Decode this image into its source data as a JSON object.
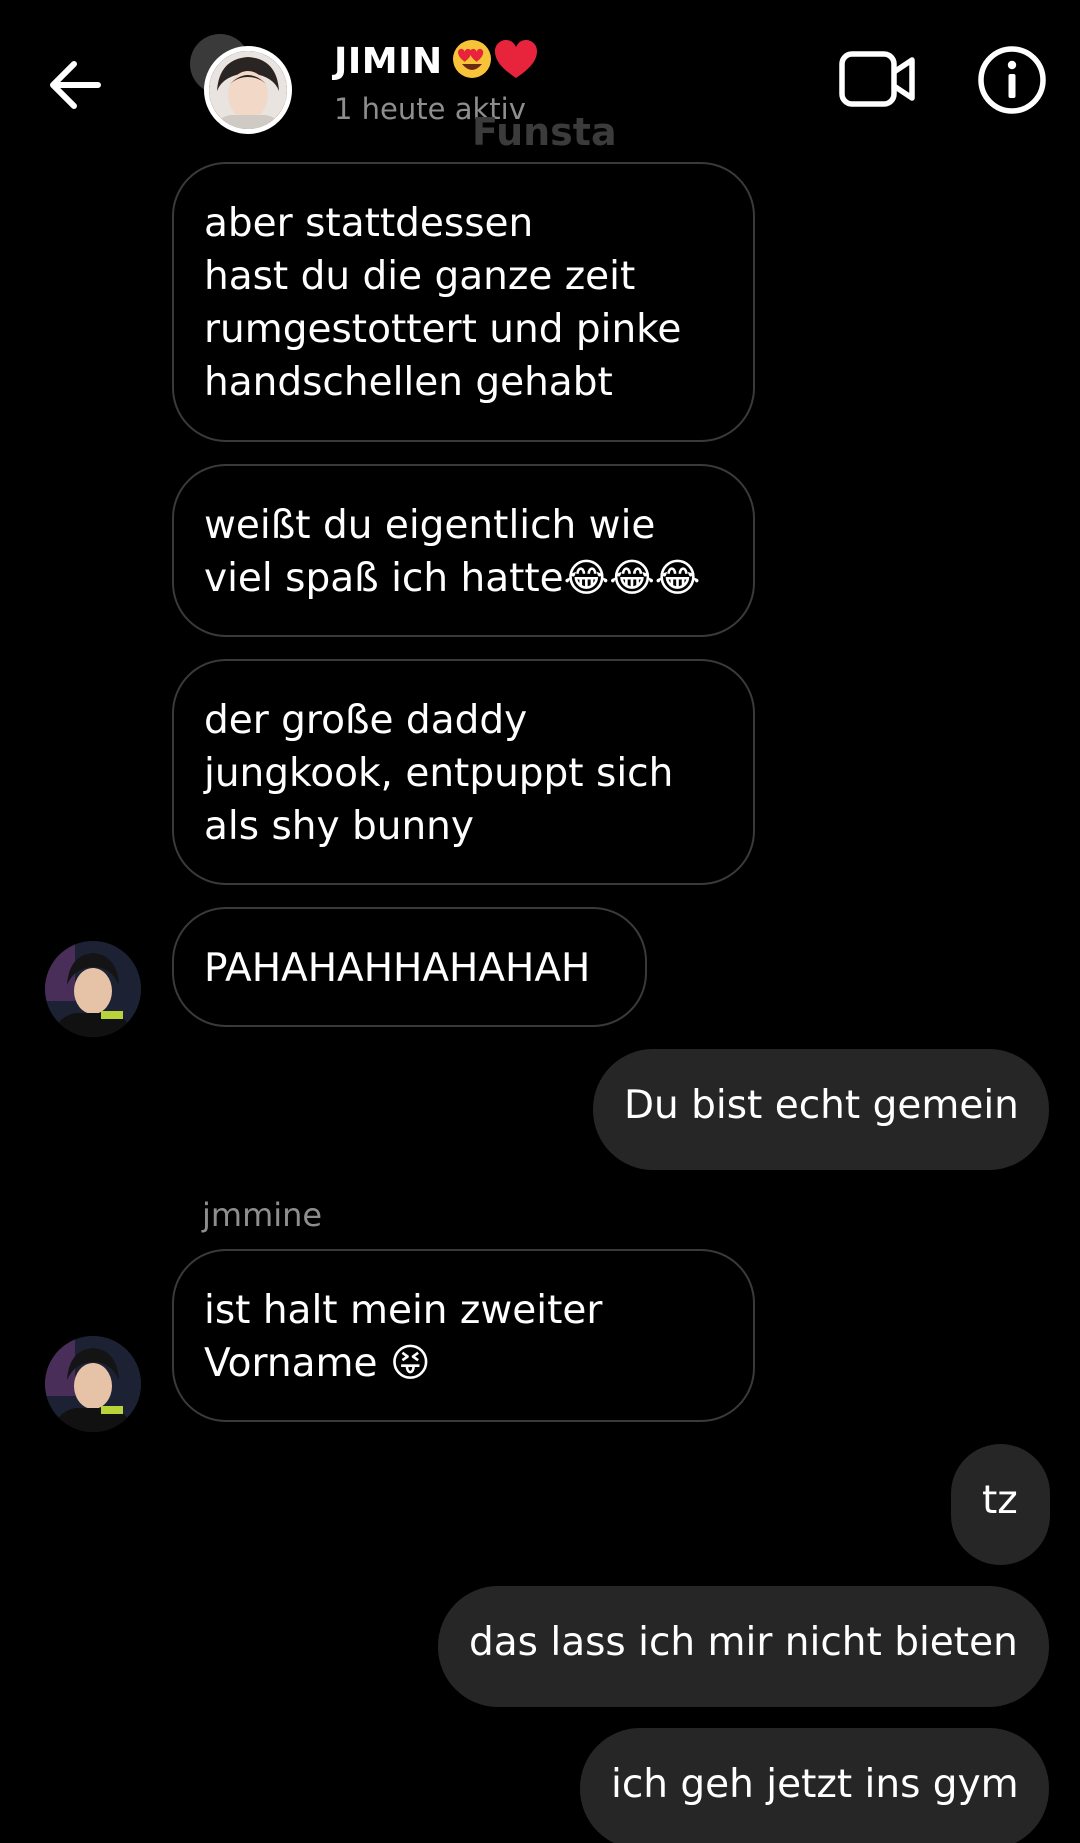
{
  "header": {
    "contact_name": "JIMIN",
    "status": "1 heute aktiv",
    "watermark": "Funsta",
    "icons": [
      "back-arrow-icon",
      "video-call-icon",
      "info-icon"
    ]
  },
  "messages": [
    {
      "id": "m1",
      "direction": "received",
      "text": "aber stattdessen\nhast du die ganze zeit\nrumgestottert und pinke\nhandschellen gehabt"
    },
    {
      "id": "m2",
      "direction": "received",
      "text": "weißt du eigentlich wie\nviel spaß ich hatte😂😂😂"
    },
    {
      "id": "m3",
      "direction": "received",
      "text": "der große daddy\njungkook, entpuppt sich\nals shy bunny"
    },
    {
      "id": "m4",
      "direction": "received",
      "text": "PAHAHAHHAHAHAH"
    },
    {
      "id": "m5",
      "direction": "sent",
      "text": "Du bist echt gemein"
    },
    {
      "id": "m6",
      "direction": "received",
      "sender": "jmmine",
      "text": "ist halt mein zweiter\nVorname 😝"
    },
    {
      "id": "m7",
      "direction": "sent",
      "text": "tz"
    },
    {
      "id": "m8",
      "direction": "sent",
      "text": "das lass ich mir nicht bieten"
    },
    {
      "id": "m9",
      "direction": "sent",
      "text": "ich geh jetzt ins gym"
    }
  ],
  "colors": {
    "background": "#000000",
    "sent_bubble": "#262626",
    "received_border": "#3a3a3a",
    "secondary_text": "#8e8e8e"
  }
}
